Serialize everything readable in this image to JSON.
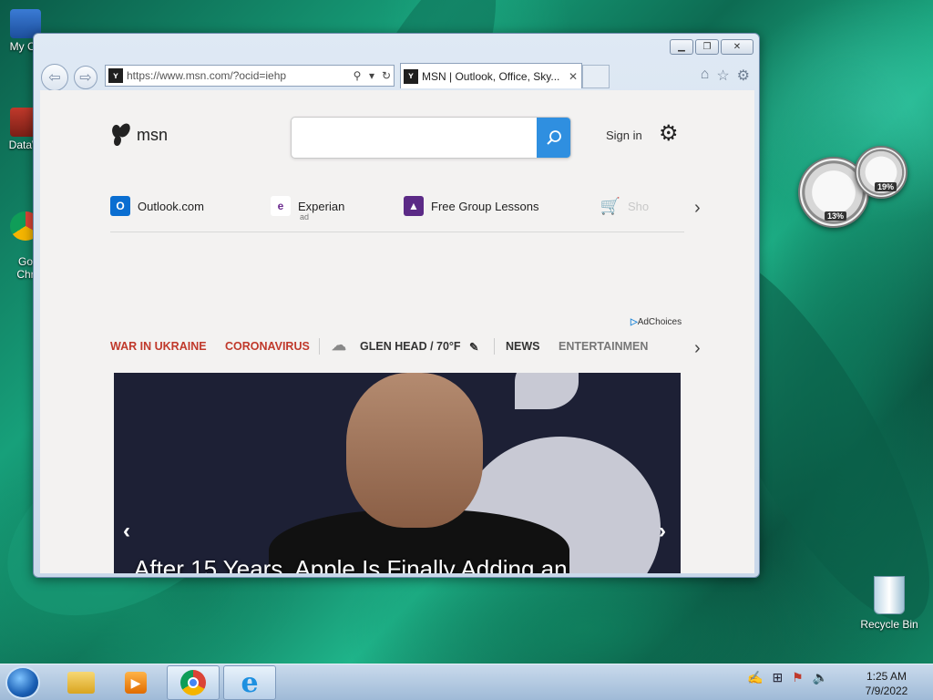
{
  "desktop": {
    "icons": [
      {
        "label": "My Co"
      },
      {
        "label": "DataW"
      },
      {
        "label": "Go\nChr"
      }
    ],
    "recycle_bin": "Recycle Bin",
    "gadgets": {
      "cpu_percent": "13%",
      "memory_percent": "19%"
    }
  },
  "browser": {
    "address_url": "https://www.msn.com/?ocid=iehp",
    "tab_title": "MSN | Outlook, Office, Sky...",
    "back_icon": "back-arrow-icon",
    "forward_icon": "forward-arrow-icon"
  },
  "msn": {
    "logo_text": "msn",
    "search_placeholder": "",
    "sign_in": "Sign in",
    "quick_links": [
      {
        "label": "Outlook.com",
        "sub": "",
        "color": "#0a6ed1"
      },
      {
        "label": "Experian",
        "sub": "ad",
        "color": "#6c2b8f"
      },
      {
        "label": "Free Group Lessons",
        "sub": "",
        "color": "#5b2a86"
      },
      {
        "label": "Sho",
        "sub": "",
        "color": "#3b8ee0"
      }
    ],
    "adchoices": "AdChoices",
    "nav": {
      "war": "WAR IN UKRAINE",
      "covid": "CORONAVIRUS",
      "weather": "GLEN HEAD / 70°F",
      "news": "NEWS",
      "entertainment": "ENTERTAINMEN"
    },
    "hero_title": "After 15 Years, Apple Is Finally Adding an"
  },
  "taskbar": {
    "time": "1:25 AM",
    "date": "7/9/2022"
  }
}
